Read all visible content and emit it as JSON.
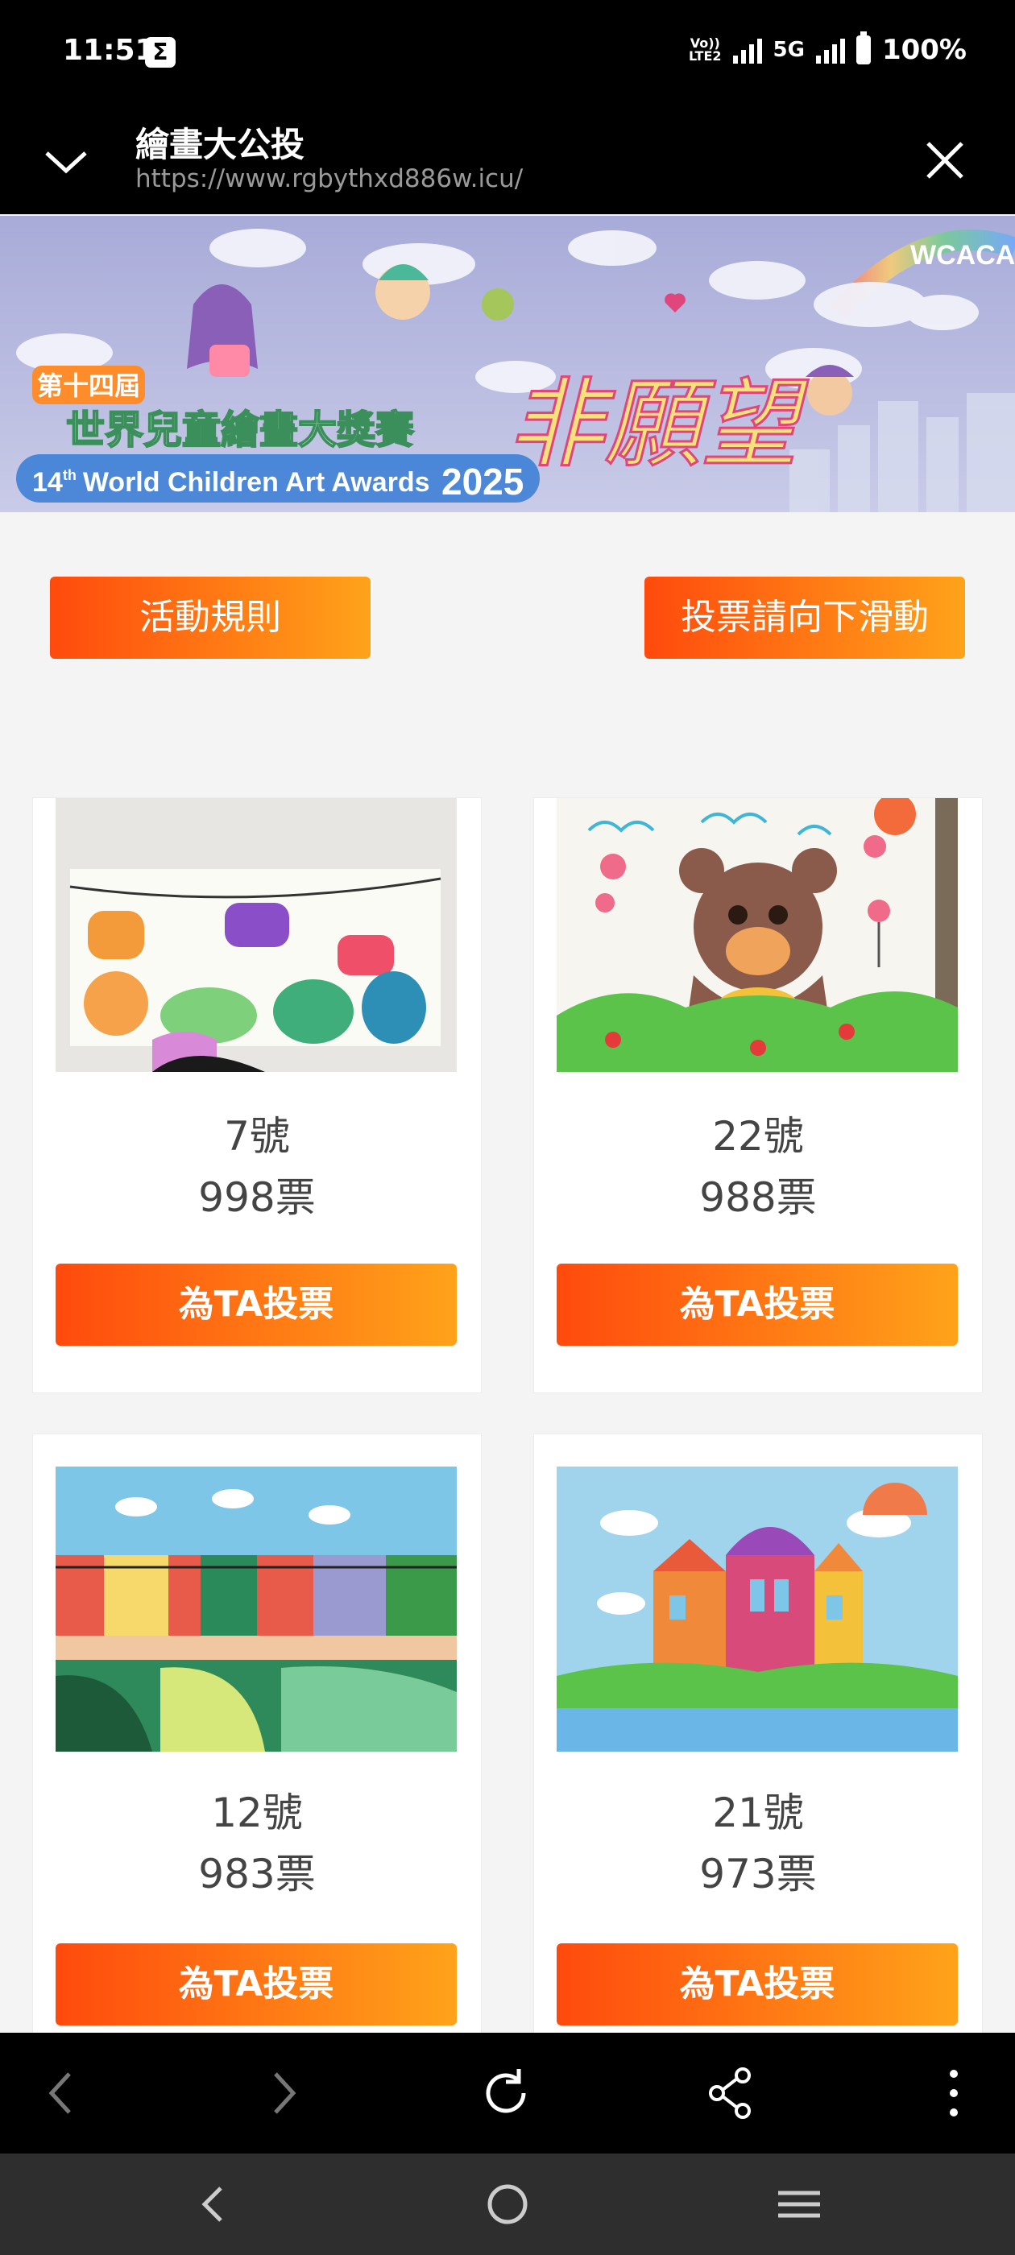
{
  "status_bar": {
    "time": "11:51",
    "network": "5G",
    "battery": "100%",
    "volte_line1": "Vo))",
    "volte_line2": "LTE2"
  },
  "browser": {
    "title": "繪畫大公投",
    "url": "https://www.rgbythxd886w.icu/"
  },
  "banner": {
    "badge": "WCACA",
    "edition": "第十四屆",
    "title": "世界兒童繪畫大獎賽",
    "english_prefix": "14",
    "english_sup": "th",
    "english": "World Children Art Awards",
    "year": "2025",
    "theme": "非願望"
  },
  "actions": {
    "rules_label": "活動規則",
    "scroll_label": "投票請向下滑動"
  },
  "entries": [
    {
      "number": "7號",
      "votes": "998票",
      "vote_label": "為TA投票"
    },
    {
      "number": "22號",
      "votes": "988票",
      "vote_label": "為TA投票"
    },
    {
      "number": "12號",
      "votes": "983票",
      "vote_label": "為TA投票"
    },
    {
      "number": "21號",
      "votes": "973票",
      "vote_label": "為TA投票"
    }
  ],
  "colors": {
    "accent_start": "#ff4a0d",
    "accent_end": "#ffa31a",
    "bar_bg": "#000000"
  }
}
